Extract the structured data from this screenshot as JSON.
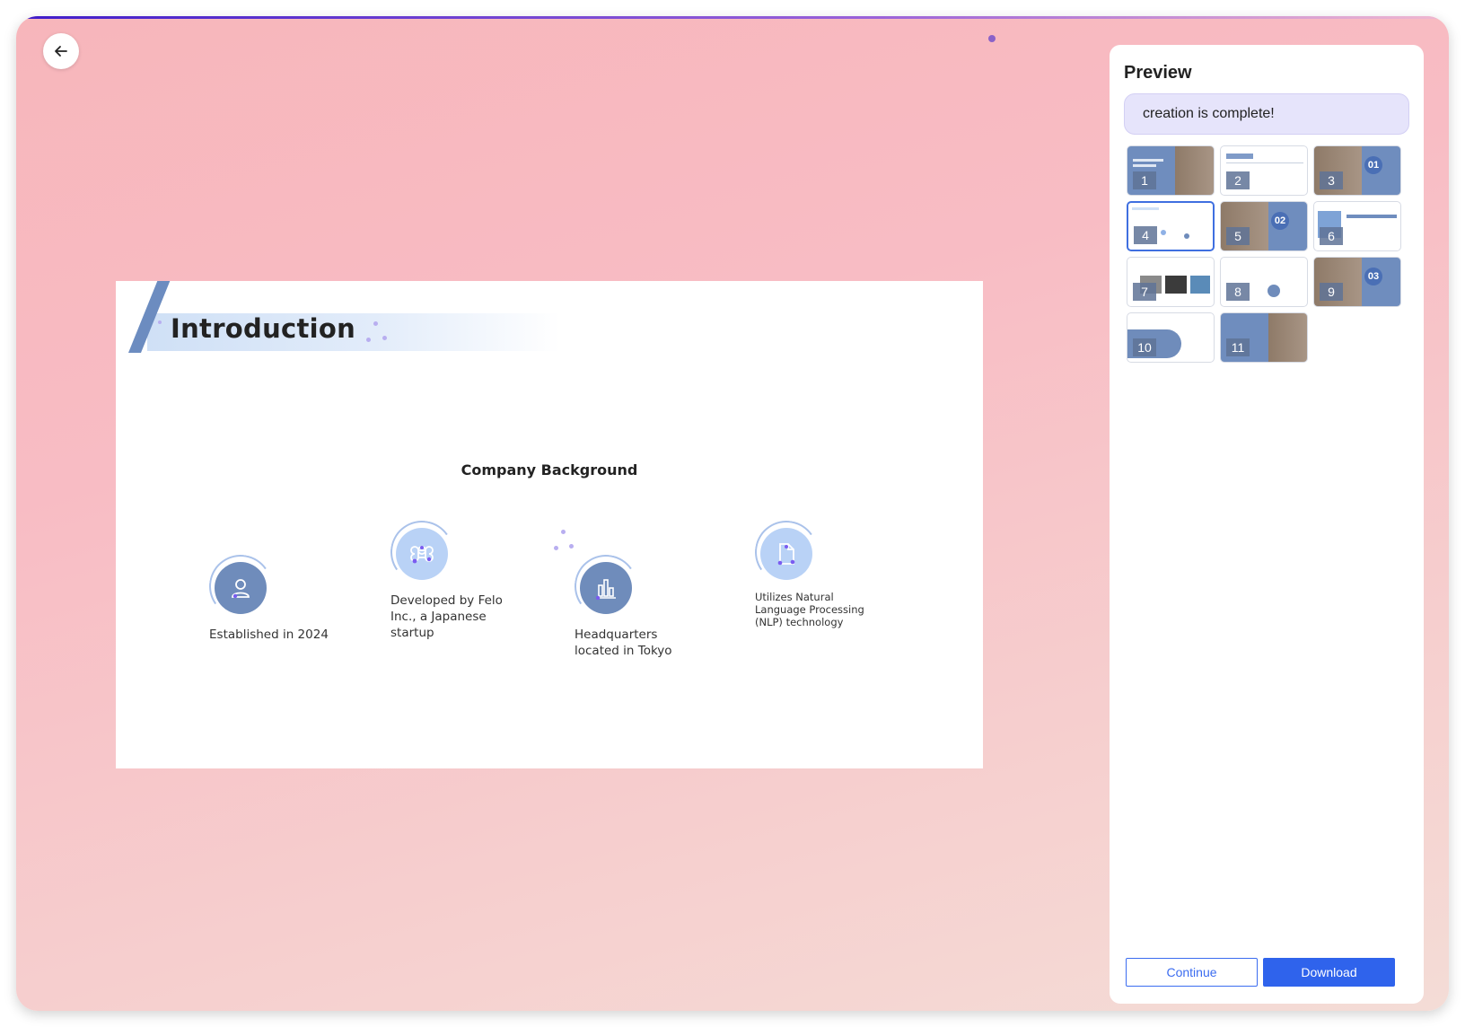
{
  "slide": {
    "title": "Introduction",
    "subtitle": "Company Background",
    "features": [
      {
        "label": "Established in 2024",
        "icon": "user-icon"
      },
      {
        "label": "Developed by Felo Inc., a Japanese startup",
        "icon": "command-icon"
      },
      {
        "label": "Headquarters located in Tokyo",
        "icon": "bar-chart-icon"
      },
      {
        "label": "Utilizes Natural Language Processing (NLP) technology",
        "icon": "document-icon"
      }
    ]
  },
  "preview": {
    "title": "Preview",
    "status": "creation is complete!",
    "thumbnails": [
      {
        "num": "1"
      },
      {
        "num": "2"
      },
      {
        "num": "3",
        "badge": "01"
      },
      {
        "num": "4"
      },
      {
        "num": "5",
        "badge": "02"
      },
      {
        "num": "6"
      },
      {
        "num": "7"
      },
      {
        "num": "8"
      },
      {
        "num": "9",
        "badge": "03"
      },
      {
        "num": "10"
      },
      {
        "num": "11"
      }
    ],
    "selected_thumbnail": "4",
    "continue_label": "Continue",
    "download_label": "Download"
  },
  "colors": {
    "accent": "#2f63ec",
    "slide_icon_dark": "#6f8cbb",
    "slide_icon_light": "#b9d2f6"
  }
}
